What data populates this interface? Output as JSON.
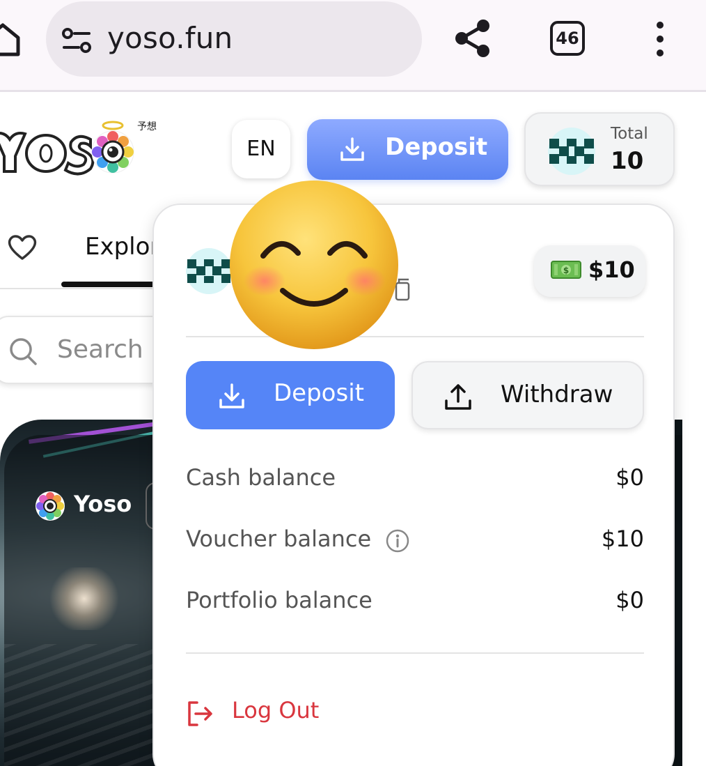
{
  "browser": {
    "url": "yoso.fun",
    "tab_count": "46"
  },
  "header": {
    "logo_text": "yoso",
    "logo_kanji": "予想",
    "lang": "EN",
    "deposit_label": "Deposit",
    "total_label": "Total",
    "total_value": "10"
  },
  "nav": {
    "explore_label": "Explore",
    "search_placeholder": "Search"
  },
  "card": {
    "brand": "Yoso"
  },
  "panel": {
    "badge_amount": "$10",
    "deposit_label": "Deposit",
    "withdraw_label": "Withdraw",
    "balances": [
      {
        "label": "Cash balance",
        "value": "$0"
      },
      {
        "label": "Voucher balance",
        "value": "$10"
      },
      {
        "label": "Portfolio balance",
        "value": "$0"
      }
    ],
    "logout_label": "Log Out"
  },
  "colors": {
    "accent": "#5585f7",
    "danger": "#d9363e",
    "avatar_teal": "#0f4d4a"
  }
}
